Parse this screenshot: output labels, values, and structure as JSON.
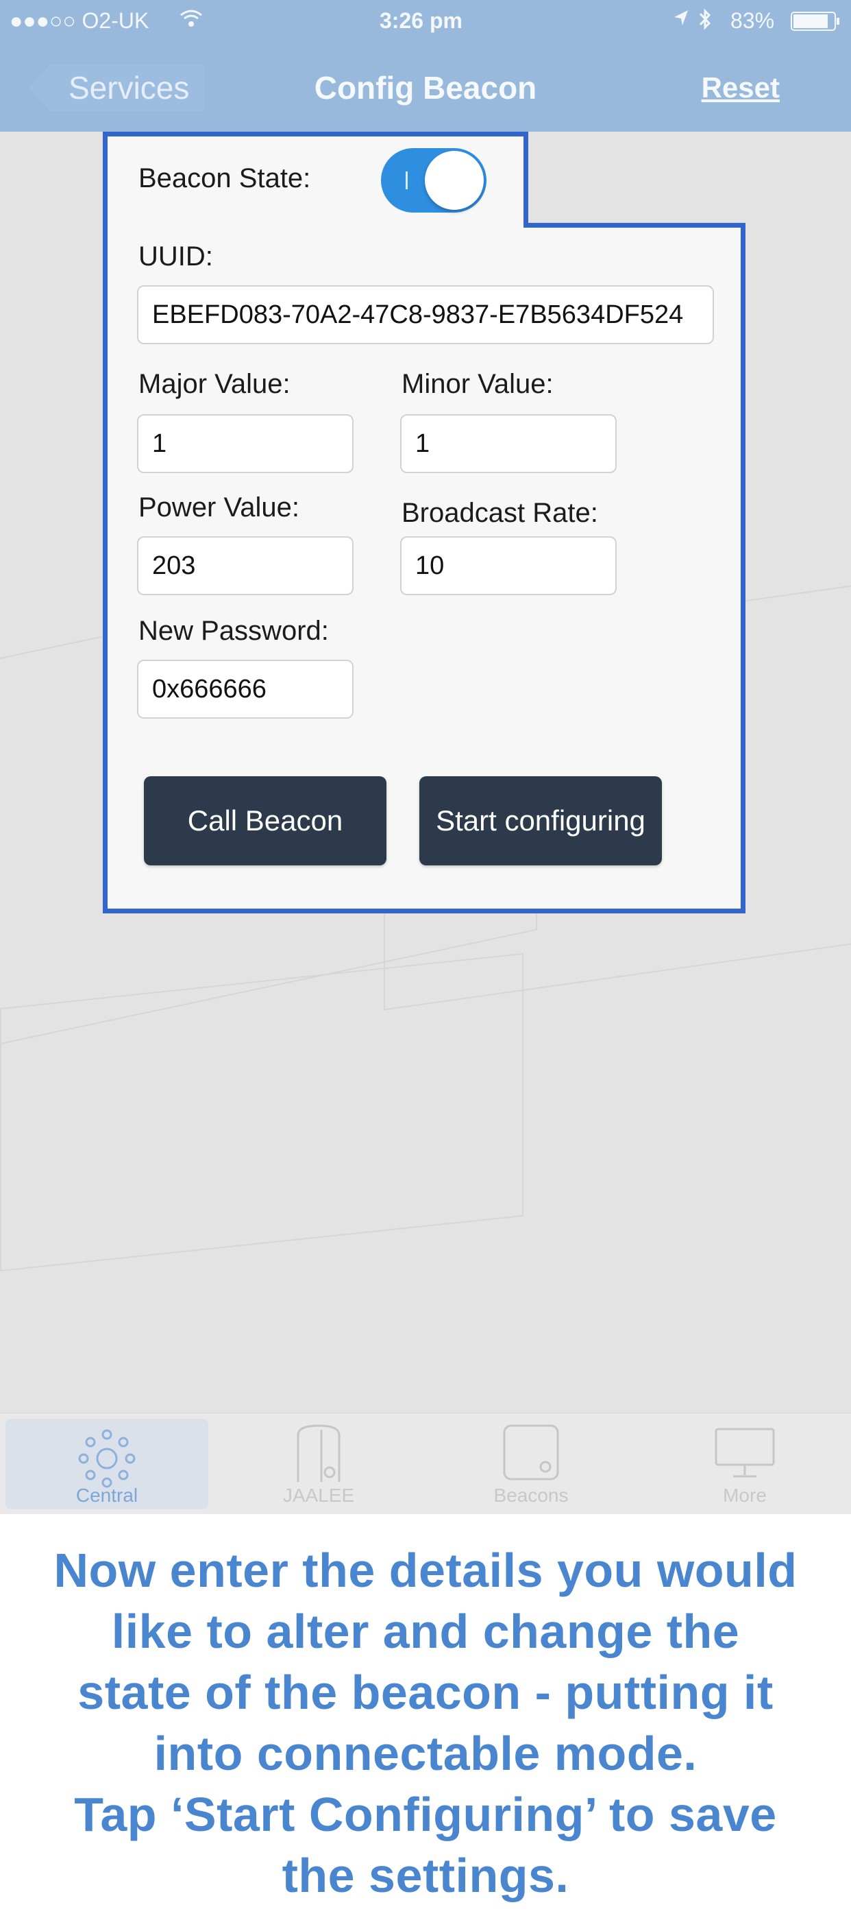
{
  "status_bar": {
    "carrier": "●●●○○ O2-UK",
    "time": "3:26 pm",
    "battery": "83%"
  },
  "nav": {
    "back_label": "Services",
    "title": "Config Beacon",
    "reset_label": "Reset"
  },
  "form": {
    "beacon_state_label": "Beacon State:",
    "beacon_state_on": true,
    "uuid_label": "UUID:",
    "uuid_value": "EBEFD083-70A2-47C8-9837-E7B5634DF524",
    "major_label": "Major Value:",
    "major_value": "1",
    "minor_label": "Minor Value:",
    "minor_value": "1",
    "power_label": "Power Value:",
    "power_value": "203",
    "rate_label": "Broadcast Rate:",
    "rate_value": "10",
    "password_label": "New Password:",
    "password_value": "0x666666",
    "call_button": "Call Beacon",
    "start_button": "Start configuring"
  },
  "tabs": [
    {
      "label": "Central",
      "icon": "central-icon",
      "active": true
    },
    {
      "label": "JAALEE",
      "icon": "jaalee-icon",
      "active": false
    },
    {
      "label": "Beacons",
      "icon": "beacons-icon",
      "active": false
    },
    {
      "label": "More",
      "icon": "monitor-icon",
      "active": false
    }
  ],
  "caption": {
    "line1": "Now enter the details you would",
    "line2": "like to alter and change the",
    "line3": "state of the beacon - putting it",
    "line4": "into connectable mode.",
    "line5": "Tap ‘Start Configuring’ to save",
    "line6": "the settings."
  },
  "colors": {
    "nav_bg": "#98b9dc",
    "panel_border": "#3366cc",
    "button_bg": "#2c3a4b",
    "toggle_on": "#2e8ee0",
    "caption_text": "#4a86cf"
  }
}
